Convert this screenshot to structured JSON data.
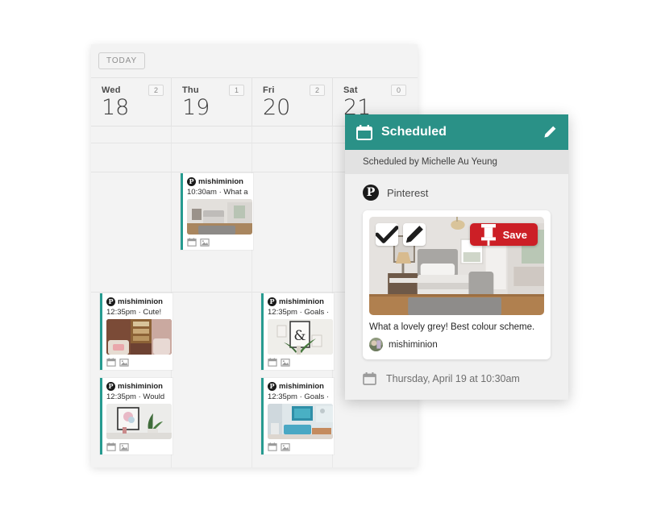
{
  "calendar": {
    "toolbar": {
      "today_label": "TODAY"
    },
    "days": [
      {
        "dow": "Wed",
        "date": "18",
        "count": "2"
      },
      {
        "dow": "Thu",
        "date": "19",
        "count": "1"
      },
      {
        "dow": "Fri",
        "date": "20",
        "count": "2"
      },
      {
        "dow": "Sat",
        "date": "21",
        "count": "0"
      }
    ],
    "posts": [
      {
        "user": "mishiminion",
        "meta": "10:30am · What a",
        "network_icon": "pinterest-icon",
        "calendar_icon": "calendar-icon",
        "image_icon": "image-icon"
      },
      {
        "user": "mishiminion",
        "meta": "12:35pm · Cute!",
        "network_icon": "pinterest-icon",
        "calendar_icon": "calendar-icon",
        "image_icon": "image-icon"
      },
      {
        "user": "mishiminion",
        "meta": "12:35pm · Would",
        "network_icon": "pinterest-icon",
        "calendar_icon": "calendar-icon",
        "image_icon": "image-icon"
      },
      {
        "user": "mishiminion",
        "meta": "12:35pm · Goals ·",
        "network_icon": "pinterest-icon",
        "calendar_icon": "calendar-icon",
        "image_icon": "image-icon"
      },
      {
        "user": "mishiminion",
        "meta": "12:35pm · Goals ·",
        "network_icon": "pinterest-icon",
        "calendar_icon": "calendar-icon",
        "image_icon": "image-icon"
      }
    ]
  },
  "popup": {
    "header": {
      "title": "Scheduled",
      "calendar_icon": "calendar-icon",
      "edit_icon": "pencil-icon"
    },
    "scheduled_by": "Scheduled by Michelle Au Yeung",
    "network": {
      "name": "Pinterest",
      "icon": "pinterest-icon"
    },
    "pin": {
      "approve_icon": "check-icon",
      "edit_icon": "pencil-icon",
      "save_label": "Save",
      "save_icon": "pushpin-icon",
      "caption": "What a lovely grey! Best colour scheme.",
      "author": "mishiminion"
    },
    "footer": {
      "datetime": "Thursday, April 19 at 10:30am",
      "calendar_icon": "calendar-icon"
    }
  },
  "colors": {
    "accent_teal": "#2a9187",
    "save_red": "#cc1f26",
    "panel_bg": "#f3f3f3",
    "subbar_bg": "#e2e2e2"
  }
}
